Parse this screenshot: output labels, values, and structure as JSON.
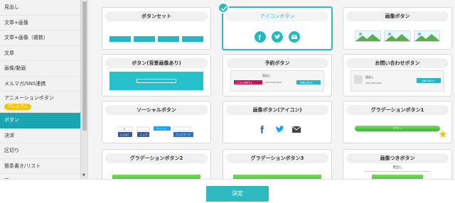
{
  "sidebar": {
    "items": [
      {
        "label": "見出し"
      },
      {
        "label": "文章+画像"
      },
      {
        "label": "文章+画像（複数）"
      },
      {
        "label": "文章"
      },
      {
        "label": "画像/動画"
      },
      {
        "label": "メルマガ/SNS連携"
      },
      {
        "label": "アニメーションボタン",
        "badge": "プレミアム"
      },
      {
        "label": "ボタン"
      },
      {
        "label": "決済"
      },
      {
        "label": "区切り"
      },
      {
        "label": "箇条書き/リスト"
      },
      {
        "label": "表"
      }
    ]
  },
  "cards": [
    {
      "title": "ボタンセット",
      "buttons": [
        "ボタン",
        "ボタン",
        "ボタン",
        "ボタン"
      ]
    },
    {
      "title": "アイコンボタン",
      "selected": true
    },
    {
      "title": "画像ボタン"
    },
    {
      "title": "ボタン(背景画像あり)",
      "button_label": "ボタン"
    },
    {
      "title": "予約ボタン",
      "heading": "見出し",
      "text": "000-0000-0000",
      "left_button": "ここから予約する",
      "right_button": "お問い合わせ"
    },
    {
      "title": "お問い合わせボタン",
      "heading": "見出し",
      "text": "000-0000-0000",
      "button_label": "お問い合わせ"
    },
    {
      "title": "ソーシャルボタン",
      "social": {
        "tweet": "ツイート",
        "like": "いいね！",
        "share": "シェア",
        "bookmark": "ブックマーク",
        "count": "0"
      }
    },
    {
      "title": "画像ボタン(アイコン)"
    },
    {
      "title": "グラデーションボタン1",
      "button_label": "ボタン"
    },
    {
      "title": "グラデーションボタン2"
    },
    {
      "title": "グラデーションボタン3"
    },
    {
      "title": "画像つきボタン",
      "heading": "見出し"
    }
  ],
  "footer": {
    "decide_label": "決定"
  },
  "colors": {
    "accent": "#2fb8c0",
    "green": "#4cc448",
    "facebook": "#3b5998",
    "twitter": "#1da1f2"
  }
}
